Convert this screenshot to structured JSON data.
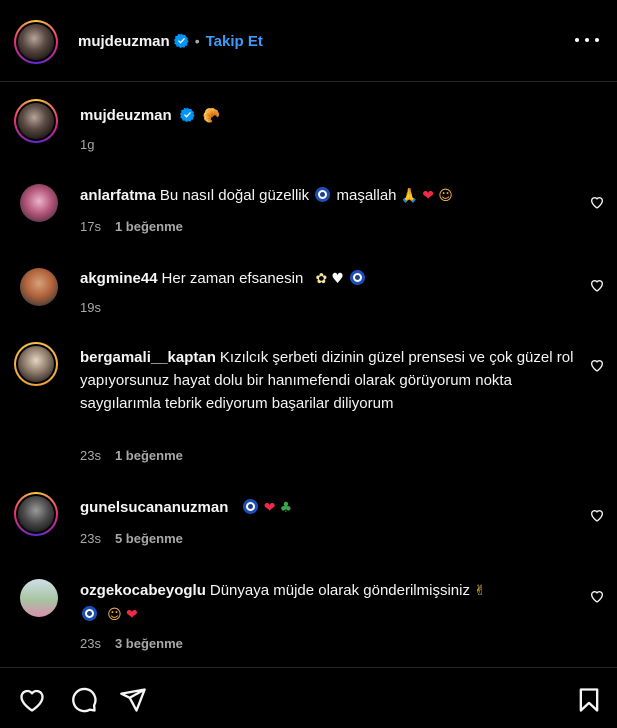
{
  "header": {
    "username": "mujdeuzman",
    "separator": "•",
    "follow_label": "Takip Et"
  },
  "caption": {
    "username": "mujdeuzman",
    "emoji": "🥐",
    "time": "1g"
  },
  "comments": [
    {
      "username": "anlarfatma",
      "text": "Bu nasıl doğal güzellik",
      "text2": "maşallah",
      "time": "17s",
      "likes": "1 beğenme"
    },
    {
      "username": "akgmine44",
      "text": "Her zaman efsanesin",
      "time": "19s",
      "likes": ""
    },
    {
      "username": "bergamali__kaptan",
      "text": "Kızılcık şerbeti dizinin güzel prensesi ve çok güzel rol yapıyorsunuz hayat dolu bir hanımefendi olarak görüyorum nokta saygılarımla tebrik ediyorum başarilar diliyorum",
      "time": "23s",
      "likes": "1 beğenme"
    },
    {
      "username": "gunelsucananuzman",
      "text": "",
      "time": "23s",
      "likes": "5 beğenme"
    },
    {
      "username": "ozgekocabeyoglu",
      "text": "Dünyaya müjde olarak gönderilmişsiniz",
      "time": "23s",
      "likes": "3 beğenme"
    }
  ],
  "colors": {
    "background": "#000000",
    "text": "#f5f5f5",
    "secondary": "#a8a8a8",
    "link": "#3e9bf7",
    "divider": "#262626"
  },
  "icons": {
    "more": "more-options-icon",
    "like": "heart-outline-icon",
    "comment": "comment-bubble-icon",
    "share": "paper-plane-icon",
    "save": "bookmark-icon",
    "verified": "verified-badge-icon"
  }
}
